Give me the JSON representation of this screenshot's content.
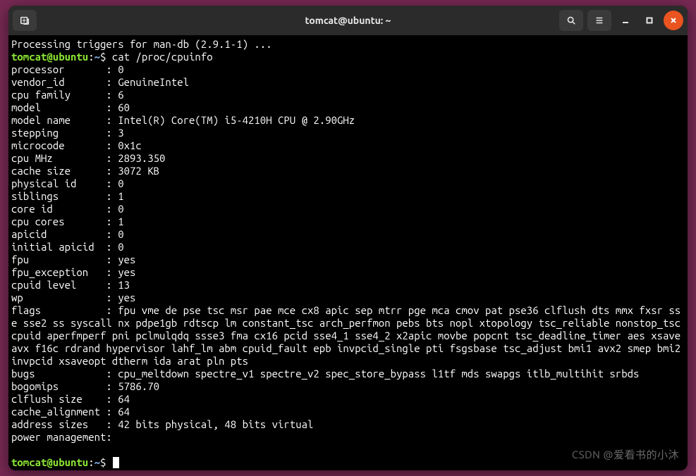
{
  "titlebar": {
    "title": "tomcat@ubuntu: ~"
  },
  "prompt": {
    "user_host": "tomcat@ubuntu",
    "path": "~",
    "symbol": "$"
  },
  "output": {
    "pre_line": "Processing triggers for man-db (2.9.1-1) ...",
    "command": "cat /proc/cpuinfo",
    "fields": [
      {
        "key": "processor",
        "value": "0"
      },
      {
        "key": "vendor_id",
        "value": "GenuineIntel"
      },
      {
        "key": "cpu family",
        "value": "6"
      },
      {
        "key": "model",
        "value": "60"
      },
      {
        "key": "model name",
        "value": "Intel(R) Core(TM) i5-4210H CPU @ 2.90GHz"
      },
      {
        "key": "stepping",
        "value": "3"
      },
      {
        "key": "microcode",
        "value": "0x1c"
      },
      {
        "key": "cpu MHz",
        "value": "2893.350"
      },
      {
        "key": "cache size",
        "value": "3072 KB"
      },
      {
        "key": "physical id",
        "value": "0"
      },
      {
        "key": "siblings",
        "value": "1"
      },
      {
        "key": "core id",
        "value": "0"
      },
      {
        "key": "cpu cores",
        "value": "1"
      },
      {
        "key": "apicid",
        "value": "0"
      },
      {
        "key": "initial apicid",
        "value": "0"
      },
      {
        "key": "fpu",
        "value": "yes"
      },
      {
        "key": "fpu_exception",
        "value": "yes"
      },
      {
        "key": "cpuid level",
        "value": "13"
      },
      {
        "key": "wp",
        "value": "yes"
      },
      {
        "key": "flags",
        "value": "fpu vme de pse tsc msr pae mce cx8 apic sep mtrr pge mca cmov pat pse36 clflush dts mmx fxsr sse sse2 ss syscall nx pdpe1gb rdtscp lm constant_tsc arch_perfmon pebs bts nopl xtopology tsc_reliable nonstop_tsc cpuid aperfmperf pni pclmulqdq ssse3 fma cx16 pcid sse4_1 sse4_2 x2apic movbe popcnt tsc_deadline_timer aes xsave avx f16c rdrand hypervisor lahf_lm abm cpuid_fault epb invpcid_single pti fsgsbase tsc_adjust bmi1 avx2 smep bmi2 invpcid xsaveopt dtherm ida arat pln pts"
      },
      {
        "key": "bugs",
        "value": "cpu_meltdown spectre_v1 spectre_v2 spec_store_bypass l1tf mds swapgs itlb_multihit srbds"
      },
      {
        "key": "bogomips",
        "value": "5786.70"
      },
      {
        "key": "clflush size",
        "value": "64"
      },
      {
        "key": "cache_alignment",
        "value": "64"
      },
      {
        "key": "address sizes",
        "value": "42 bits physical, 48 bits virtual"
      },
      {
        "key": "power management",
        "value": ""
      }
    ]
  },
  "watermark": "CSDN @爱看书的小沐"
}
